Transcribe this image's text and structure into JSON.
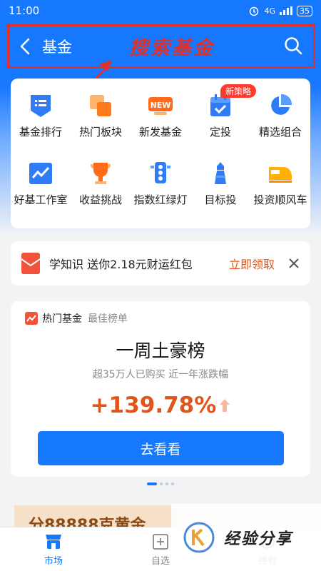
{
  "status_bar": {
    "time": "11:00",
    "network": "4G",
    "battery": "35"
  },
  "header": {
    "title": "基金",
    "annotation": "搜索基金"
  },
  "grid": {
    "row1": [
      {
        "label": "基金排行",
        "icon": "fund-ranking-icon"
      },
      {
        "label": "热门板块",
        "icon": "hot-sector-icon"
      },
      {
        "label": "新发基金",
        "icon": "new-fund-icon"
      },
      {
        "label": "定投",
        "icon": "calendar-check-icon",
        "badge": "新策略"
      },
      {
        "label": "精选组合",
        "icon": "pie-chart-icon"
      }
    ],
    "row2": [
      {
        "label": "好基工作室",
        "icon": "chart-trend-icon"
      },
      {
        "label": "收益挑战",
        "icon": "trophy-icon"
      },
      {
        "label": "指数红绿灯",
        "icon": "traffic-light-icon"
      },
      {
        "label": "目标投",
        "icon": "lighthouse-icon"
      },
      {
        "label": "投资顺风车",
        "icon": "train-icon"
      }
    ]
  },
  "promo": {
    "text": "学知识 送你2.18元财运红包",
    "action": "立即领取"
  },
  "fund_card": {
    "head_label": "热门基金",
    "head_sub": "最佳榜单",
    "title": "一周土豪榜",
    "subtitle": "超35万人已购买 近一年涨跌幅",
    "value": "+139.78%",
    "button": "去看看"
  },
  "peek_card": {
    "text": "分88888克黄金"
  },
  "tabs": [
    {
      "label": "市场",
      "active": true
    },
    {
      "label": "自选",
      "active": false
    },
    {
      "label": "持有",
      "active": false
    }
  ],
  "watermark": {
    "text": "经验分享"
  },
  "colors": {
    "primary": "#1677ff",
    "accent": "#e0551b",
    "annotation": "#e0302a"
  }
}
